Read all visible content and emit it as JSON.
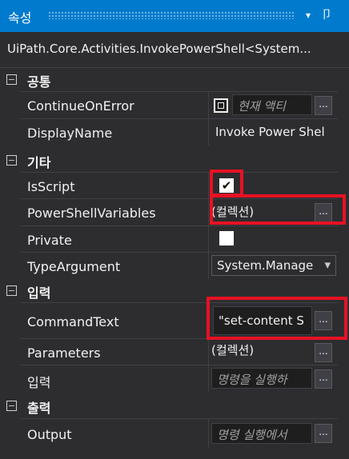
{
  "panel": {
    "title": "속성",
    "dropdown_glyph": "▾",
    "pin_glyph": "卩"
  },
  "object_name": "UiPath.Core.Activities.InvokePowerShell<System...",
  "categories": [
    {
      "label": "공통",
      "toggle": "−",
      "properties": [
        {
          "name": "ContinueOnError",
          "value": "현재 액티",
          "kind": "checkbox-text"
        },
        {
          "name": "DisplayName",
          "value": "Invoke Power Shel",
          "kind": "text"
        }
      ]
    },
    {
      "label": "기타",
      "toggle": "−",
      "properties": [
        {
          "name": "IsScript",
          "value": "checked",
          "kind": "checkbox"
        },
        {
          "name": "PowerShellVariables",
          "value": "(컬렉션)",
          "kind": "collection"
        },
        {
          "name": "Private",
          "value": "unchecked",
          "kind": "checkbox"
        },
        {
          "name": "TypeArgument",
          "value": "System.Manage",
          "kind": "dropdown"
        }
      ]
    },
    {
      "label": "입력",
      "toggle": "−",
      "properties": [
        {
          "name": "CommandText",
          "value": "\"set-content S",
          "kind": "text-button"
        },
        {
          "name": "Parameters",
          "value": "(컬렉션)",
          "kind": "collection"
        },
        {
          "name": "입력",
          "value": "명령을 실행하",
          "kind": "placeholder-button"
        }
      ]
    },
    {
      "label": "출력",
      "toggle": "−",
      "properties": [
        {
          "name": "Output",
          "value": "명령 실행에서",
          "kind": "placeholder-button"
        }
      ]
    }
  ],
  "ellipsis": "...",
  "check_glyph": "✔",
  "dropdown_arrow": "▾",
  "colors": {
    "accent": "#007acc",
    "background": "#2d2d30",
    "highlight": "#e81123"
  }
}
